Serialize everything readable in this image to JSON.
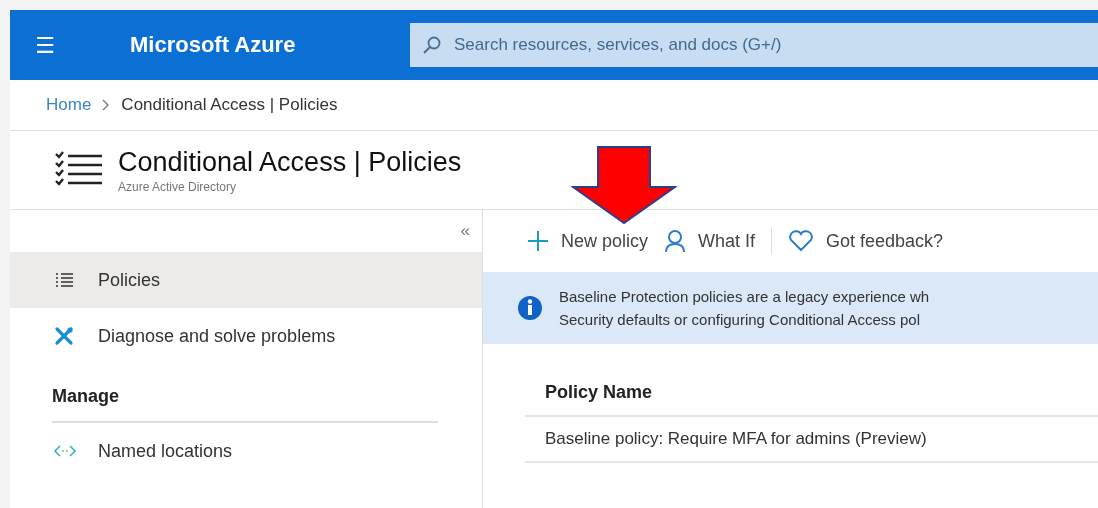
{
  "topbar": {
    "menu": "☰",
    "brand": "Microsoft Azure",
    "search": {
      "placeholder": "Search resources, services, and docs (G+/)"
    }
  },
  "breadcrumb": [
    {
      "label": "Home"
    },
    {
      "label": "Conditional Access | Policies"
    }
  ],
  "header": {
    "title": "Conditional Access | Policies",
    "subtitle": "Azure Active Directory"
  },
  "sidebar": {
    "collapse": "«",
    "items": [
      {
        "kind": "item",
        "label": "Policies",
        "selected": true
      },
      {
        "kind": "item",
        "label": "Diagnose and solve problems",
        "selected": false
      },
      {
        "kind": "section",
        "label": "Manage"
      },
      {
        "kind": "item",
        "label": "Named locations",
        "selected": false
      }
    ]
  },
  "toolbar": [
    {
      "label": "New policy"
    },
    {
      "label": "What If"
    },
    {
      "label": "Got feedback?"
    }
  ],
  "banner": {
    "lines": [
      "Baseline Protection policies are a legacy experience wh",
      "Security defaults or configuring Conditional Access pol"
    ]
  },
  "table": {
    "columns": [
      "Policy Name"
    ],
    "rows": [
      [
        "Baseline policy: Require MFA for admins (Preview)"
      ]
    ]
  }
}
